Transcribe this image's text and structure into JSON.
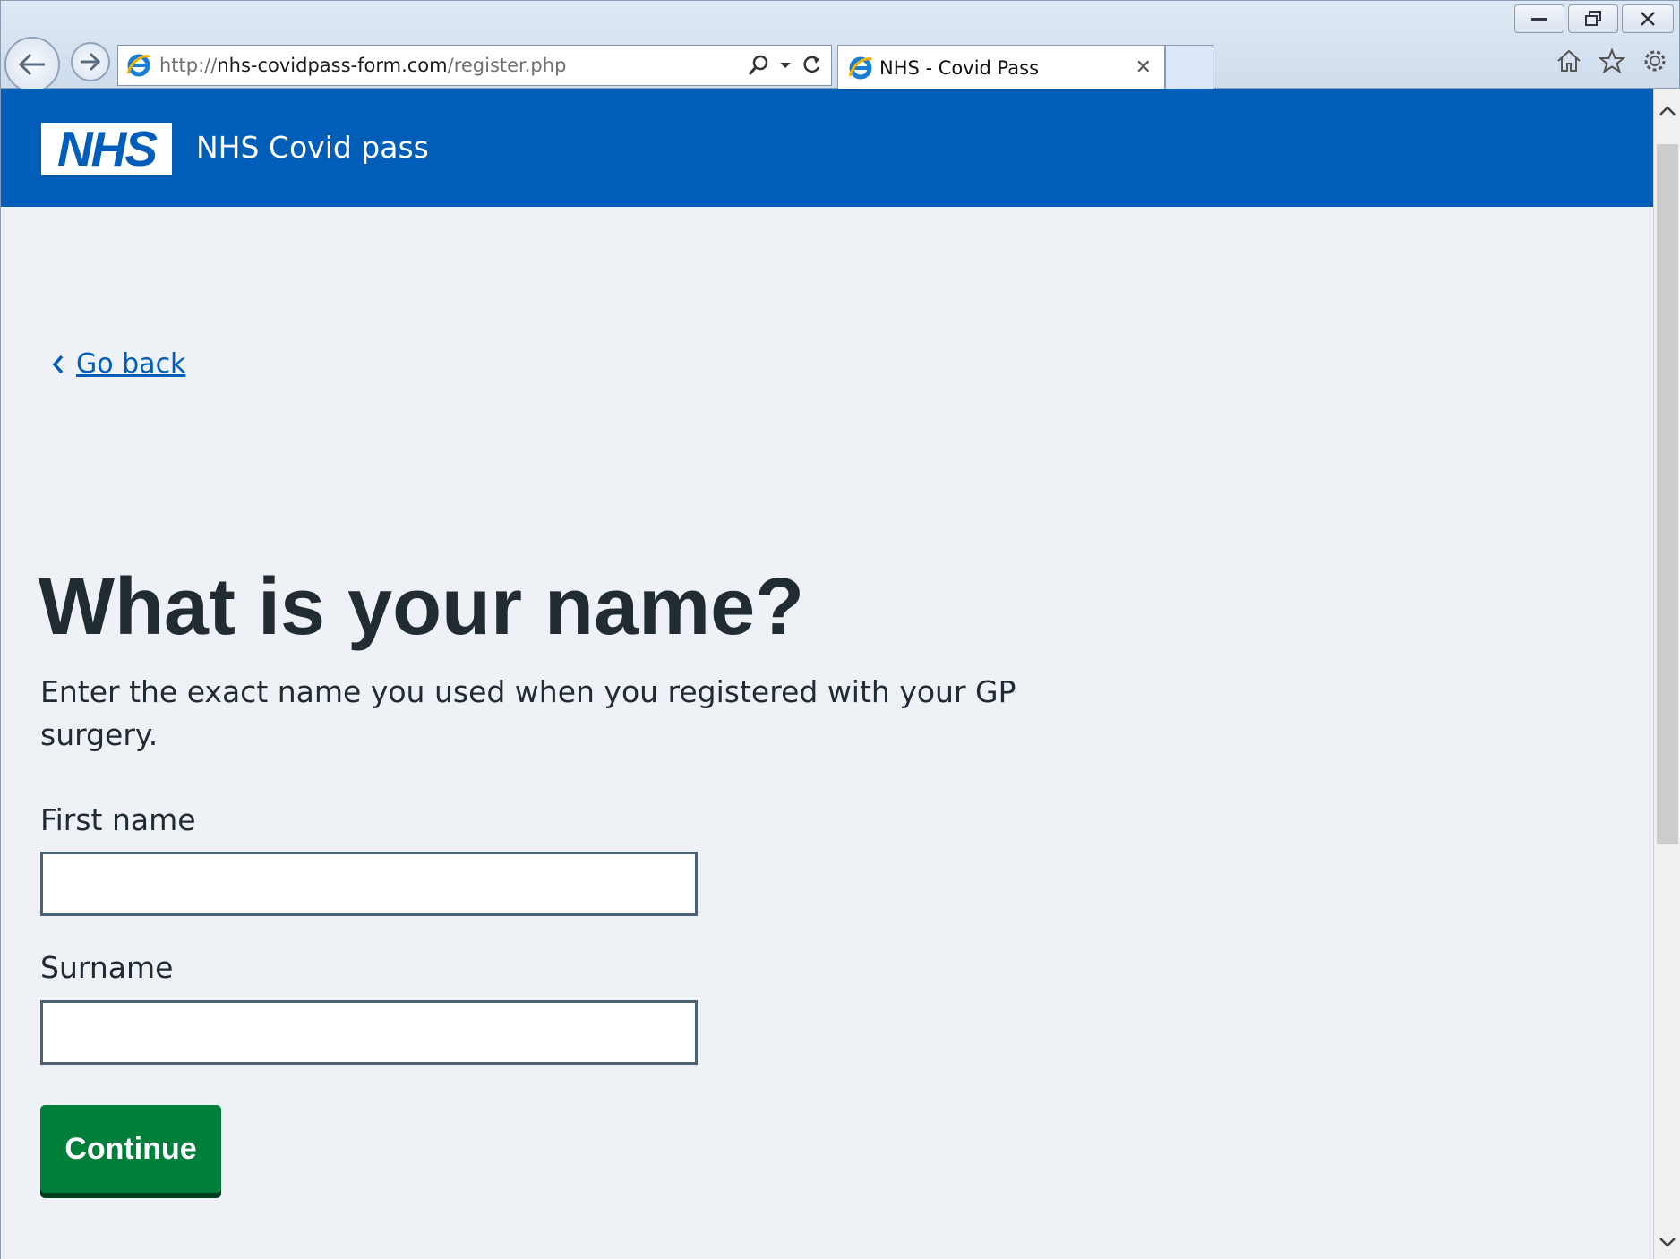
{
  "browser": {
    "url_prefix": "http://",
    "url_domain": "nhs-covidpass-form.com",
    "url_path": "/register.php",
    "tab_title": "NHS - Covid Pass",
    "tab_close": "✕"
  },
  "header": {
    "logo_text": "NHS",
    "service_name": "NHS Covid pass"
  },
  "page": {
    "back_link": "Go back",
    "heading": "What is your name?",
    "hint": "Enter the exact name you used when you registered with your GP surgery.",
    "first_name_label": "First name",
    "first_name_value": "",
    "surname_label": "Surname",
    "surname_value": "",
    "continue_label": "Continue"
  },
  "colors": {
    "nhs_blue": "#005eb8",
    "continue_green": "#007f3b",
    "page_background": "#eef2f6",
    "text": "#212b32"
  }
}
